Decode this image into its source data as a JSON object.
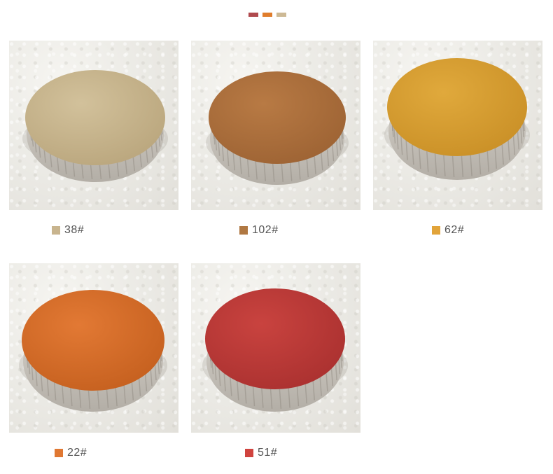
{
  "top_swatches": [
    {
      "color": "#b04a4e"
    },
    {
      "color": "#e07d2c"
    },
    {
      "color": "#cdb995"
    }
  ],
  "items": [
    {
      "code": "38#",
      "swatch": "#c8b48e",
      "top": "#d2c19b",
      "topDark": "#b9a57c"
    },
    {
      "code": "102#",
      "swatch": "#b07842",
      "top": "#b87a44",
      "topDark": "#9c6233"
    },
    {
      "code": "62#",
      "swatch": "#e2a43a",
      "top": "#e0a93c",
      "topDark": "#c98f26"
    },
    {
      "code": "22#",
      "swatch": "#e07832",
      "top": "#e27934",
      "topDark": "#c45f1e"
    },
    {
      "code": "51#",
      "swatch": "#d0433e",
      "top": "#c9433f",
      "topDark": "#a9302f"
    }
  ]
}
